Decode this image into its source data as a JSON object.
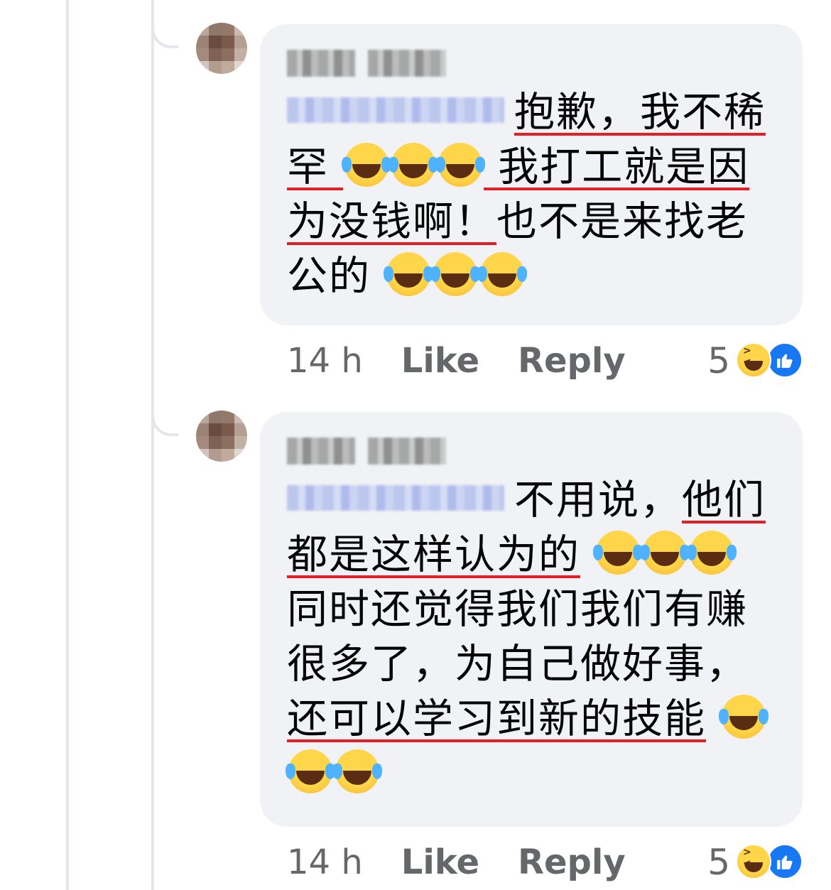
{
  "comments": [
    {
      "username": "Ling Ling",
      "tagged_user": "Blurred Name",
      "line1": "抱歉，我不稀",
      "line2_a": "罕",
      "line2_b": "我打工就是因",
      "line3_ul": "为没钱啊！",
      "line3_rest": "也不是来找老",
      "line4": "公的",
      "time": "14 h",
      "like_label": "Like",
      "reply_label": "Reply",
      "reaction_count": "5"
    },
    {
      "username": "Ling Ling",
      "tagged_user": "Blurred Name",
      "line1_a": "不用说，",
      "line1_ul": "他们",
      "line2_ul": "都是这样认为的",
      "line3": "同时还觉得我们我们有赚",
      "line4": "很多了，为自己做好事，",
      "line5_ul": "还可以学习到新的技能",
      "time": "14 h",
      "like_label": "Like",
      "reply_label": "Reply",
      "reaction_count": "5"
    }
  ],
  "icons": {
    "emoji": "face-with-tears-of-joy-icon",
    "reaction_haha": "haha-reaction-icon",
    "reaction_like": "like-reaction-icon"
  },
  "colors": {
    "bubble": "#f0f2f5",
    "underline": "#e41e26",
    "meta_text": "#65676b",
    "like_blue": "#1877f2"
  }
}
